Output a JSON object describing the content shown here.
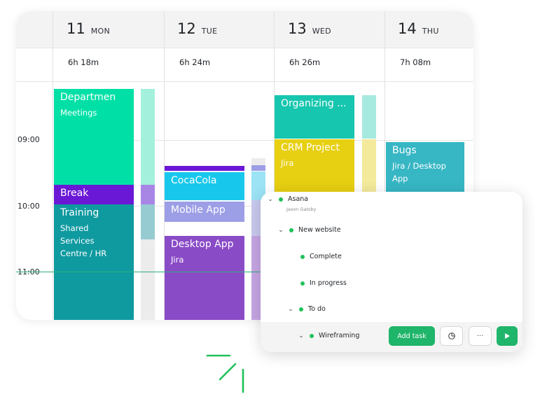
{
  "days": [
    {
      "num": "11",
      "name": "MON",
      "duration": "6h 18m"
    },
    {
      "num": "12",
      "name": "TUE",
      "duration": "6h 24m"
    },
    {
      "num": "13",
      "name": "WED",
      "duration": "6h 26m"
    },
    {
      "num": "14",
      "name": "THU",
      "duration": "7h 08m"
    }
  ],
  "times": [
    "09:00",
    "10:00",
    "11:00"
  ],
  "events": {
    "mon_department": {
      "title": "Departmen",
      "subtitle": "Meetings"
    },
    "mon_break": {
      "title": "Break"
    },
    "mon_training": {
      "title": "Training",
      "subtitle": "Shared\nServices\nCentre / HR"
    },
    "tue_cocacola": {
      "title": "CocaCola"
    },
    "tue_mobile": {
      "title": "Mobile App"
    },
    "tue_desktop": {
      "title": "Desktop App",
      "subtitle": "Jira"
    },
    "wed_organizing": {
      "title": "Organizing ..."
    },
    "wed_crm": {
      "title": "CRM Project",
      "subtitle": "Jira"
    },
    "thu_bugs": {
      "title": "Bugs",
      "subtitle": "Jira / Desktop\nApp"
    }
  },
  "panel": {
    "project": "Asana",
    "owner": "Jason Gatsby",
    "items": {
      "new_website": "New website",
      "complete": "Complete",
      "in_progress": "In progress",
      "to_do": "To do",
      "wireframing": "Wireframing"
    },
    "add_task_label": "Add task",
    "more_label": "···"
  },
  "colors": {
    "green_accent": "#1fb56a",
    "mint": "#00e0a6",
    "purple": "#6a17d6",
    "teal_dark": "#0f9aa0",
    "cyan": "#17c8ec",
    "lavender": "#9c9ee6",
    "violet": "#8a4bc7",
    "teal": "#17c6ae",
    "mustard": "#e7cf12",
    "teal_blue": "#37b6c4"
  }
}
